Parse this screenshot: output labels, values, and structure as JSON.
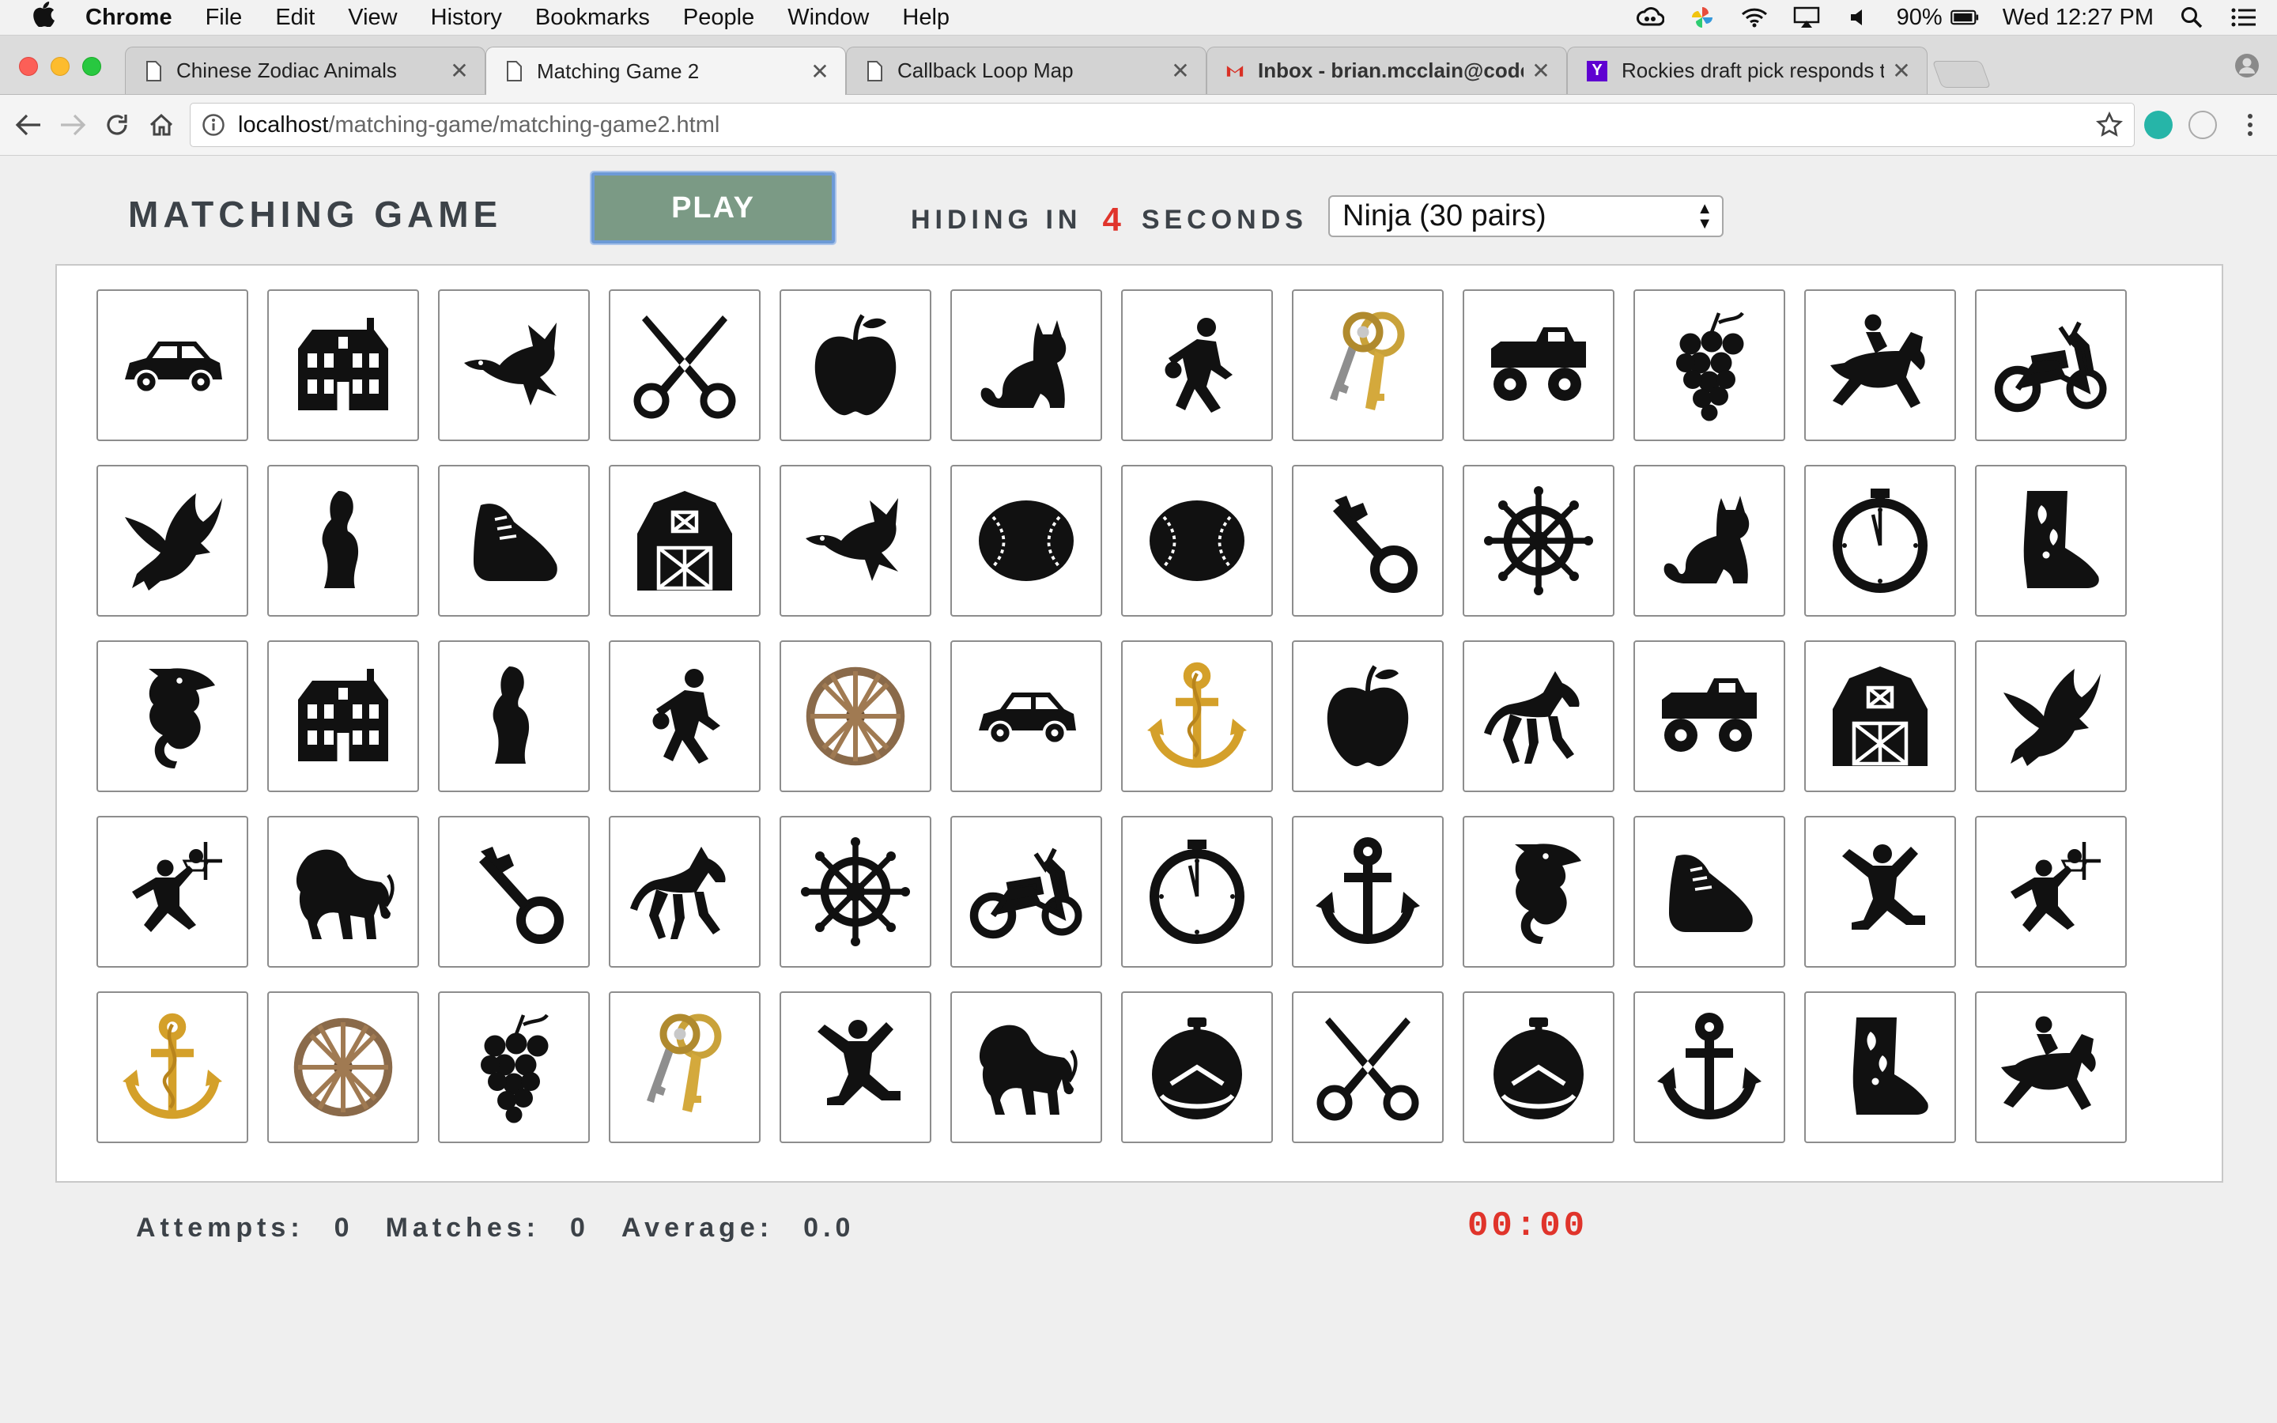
{
  "menubar": {
    "app_name": "Chrome",
    "menus": [
      "File",
      "Edit",
      "View",
      "History",
      "Bookmarks",
      "People",
      "Window",
      "Help"
    ],
    "battery": "90%",
    "clock": "Wed 12:27 PM"
  },
  "tabs": [
    {
      "title": "Chinese Zodiac Animals",
      "icon": "page-icon"
    },
    {
      "title": "Matching Game 2",
      "icon": "page-icon",
      "active": true
    },
    {
      "title": "Callback Loop Map",
      "icon": "page-icon"
    },
    {
      "title": "Inbox - brian.mcclain@codeim",
      "icon": "gmail-icon"
    },
    {
      "title": "Rockies draft pick responds to",
      "icon": "yahoo-icon"
    }
  ],
  "address": {
    "host": "localhost",
    "path": "/matching-game/matching-game2.html"
  },
  "game": {
    "title": "MATCHING GAME",
    "play_label": "PLAY",
    "hiding_prefix": "HIDING IN",
    "hiding_seconds": "4",
    "hiding_suffix": "SECONDS",
    "difficulty_selected": "Ninja (30 pairs)"
  },
  "cards": [
    [
      "car",
      "house",
      "duck",
      "scissors",
      "apple",
      "cat",
      "basketball-player",
      "keys",
      "monster-truck",
      "grapes",
      "jockey",
      "motorcycle"
    ],
    [
      "eagle",
      "thinker",
      "sneaker",
      "barn",
      "duck",
      "baseball",
      "baseball",
      "key",
      "ship-wheel",
      "cat",
      "stopwatch",
      "cowboy-boot"
    ],
    [
      "seahorse",
      "house",
      "thinker",
      "basketball-player",
      "wagon-wheel",
      "car",
      "gold-anchor",
      "apple",
      "horse",
      "monster-truck",
      "barn",
      "eagle"
    ],
    [
      "slam-dunk",
      "lion",
      "key",
      "horse",
      "ship-wheel",
      "motorcycle",
      "stopwatch",
      "anchor",
      "seahorse",
      "sneaker",
      "jumper",
      "slam-dunk"
    ],
    [
      "gold-anchor",
      "wagon-wheel",
      "grapes",
      "keys",
      "jumper",
      "lion",
      "pocket-watch",
      "scissors",
      "pocket-watch",
      "anchor",
      "cowboy-boot",
      "jockey"
    ]
  ],
  "stats": {
    "attempts_label": "Attempts:",
    "attempts": "0",
    "matches_label": "Matches:",
    "matches": "0",
    "average_label": "Average:",
    "average": "0.0",
    "timer": "00:00"
  },
  "colors": {
    "accent_red": "#e0342b",
    "play_button": "#7b9a85",
    "heading_text": "#3c4248"
  }
}
